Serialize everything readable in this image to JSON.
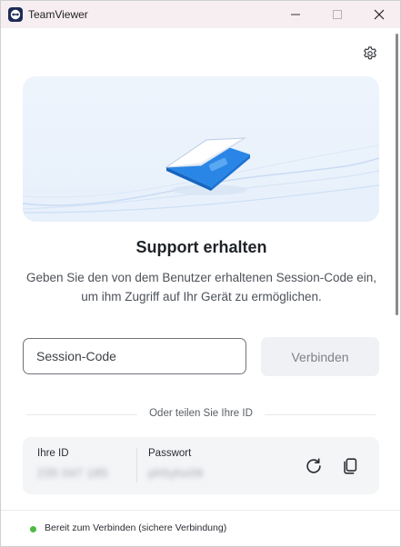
{
  "window": {
    "title": "TeamViewer"
  },
  "icons": {
    "app": "teamviewer-logo-icon",
    "minimize": "minimize-icon",
    "maximize": "maximize-icon",
    "close": "close-icon",
    "settings": "gear-icon",
    "refresh": "refresh-icon",
    "copy": "copy-icon",
    "status": "status-dot-icon"
  },
  "main": {
    "title": "Support erhalten",
    "description": "Geben Sie den von dem Benutzer erhaltenen Session-Code ein, um ihm Zugriff auf Ihr Gerät zu ermöglichen.",
    "session_input": {
      "value": "",
      "placeholder": "Session-Code"
    },
    "connect_label": "Verbinden",
    "share_label": "Oder teilen Sie Ihre ID"
  },
  "id_card": {
    "id_label": "Ihre ID",
    "id_value": "235 047 185",
    "password_label": "Passwort",
    "password_value": "ph5yhx09"
  },
  "status": {
    "text": "Bereit zum Verbinden (sichere Verbindung)",
    "color": "#4cba42"
  },
  "colors": {
    "titlebar": "#f7eef2",
    "accent": "#1a73e8",
    "hero_bg": "#e9f1fb"
  }
}
